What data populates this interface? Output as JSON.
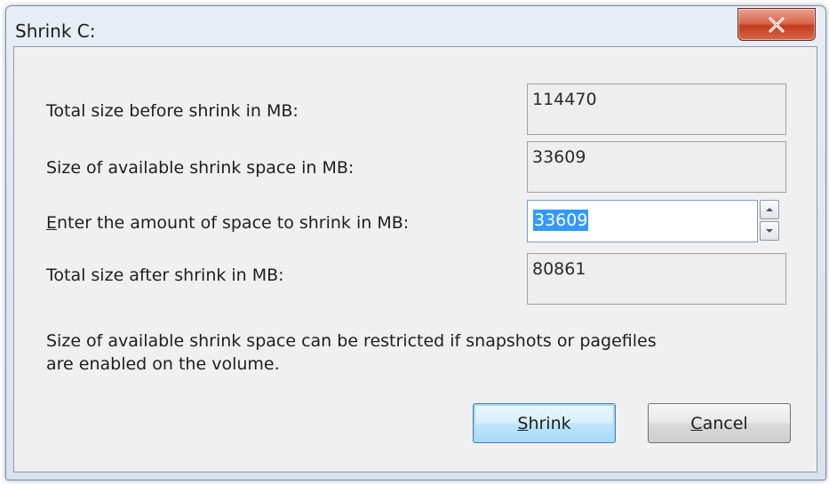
{
  "window": {
    "title": "Shrink C:"
  },
  "fields": [
    {
      "label": "Total size before shrink in MB:",
      "value": "114470"
    },
    {
      "label": "Size of available shrink space in MB:",
      "value": "33609"
    },
    {
      "label_mnemonic": "E",
      "label_rest": "nter the amount of space to shrink in MB:",
      "value": "33609"
    },
    {
      "label": "Total size after shrink in MB:",
      "value": "80861"
    }
  ],
  "note": {
    "line1": "Size of available shrink space can be restricted if snapshots or pagefiles",
    "line2": "are enabled on the volume."
  },
  "buttons": {
    "shrink_mnemonic": "S",
    "shrink_rest": "hrink",
    "cancel_mnemonic": "C",
    "cancel_rest": "ancel"
  },
  "icons": {
    "close": "close-icon",
    "spin_up": "chevron-up-icon",
    "spin_down": "chevron-down-icon"
  },
  "colors": {
    "close_button": "#c23b1e",
    "selection": "#3399ff",
    "default_button": "#a7d8f5"
  }
}
